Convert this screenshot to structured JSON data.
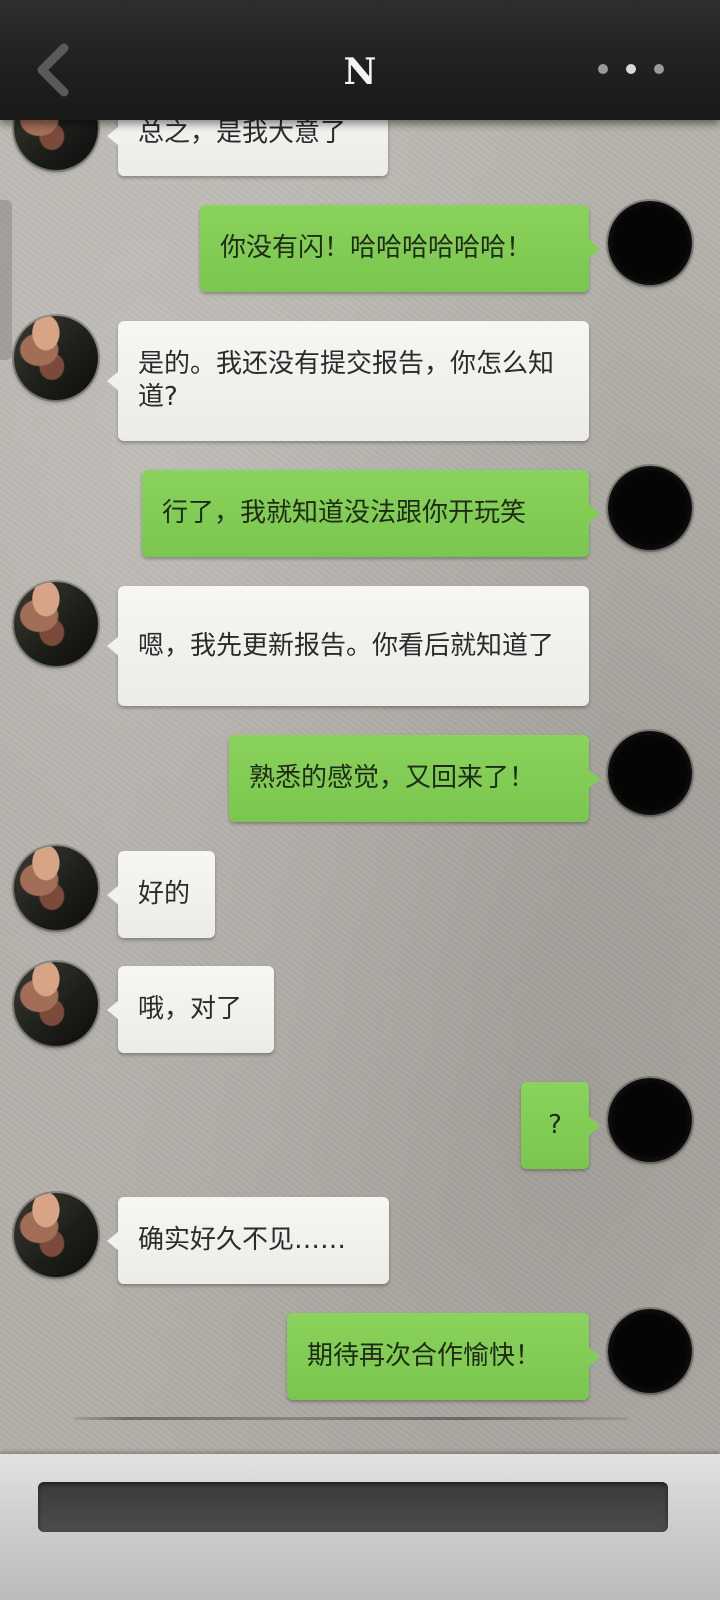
{
  "header": {
    "title": "N",
    "back_icon": "chevron-left-icon",
    "more_icon": "more-dots-icon"
  },
  "messages": [
    {
      "side": "left",
      "text": "总之，是我大意了"
    },
    {
      "side": "right",
      "text": "你没有闪！哈哈哈哈哈哈！"
    },
    {
      "side": "left",
      "text": "是的。我还没有提交报告，你怎么知道?"
    },
    {
      "side": "right",
      "text": "行了，我就知道没法跟你开玩笑"
    },
    {
      "side": "left",
      "text": "嗯，我先更新报告。你看后就知道了"
    },
    {
      "side": "right",
      "text": "熟悉的感觉，又回来了！"
    },
    {
      "side": "left",
      "text": "好的"
    },
    {
      "side": "left",
      "text": "哦，对了"
    },
    {
      "side": "right",
      "text": "?"
    },
    {
      "side": "left",
      "text": "确实好久不见……"
    },
    {
      "side": "right",
      "text": "期待再次合作愉快！"
    }
  ],
  "input": {
    "value": "",
    "placeholder": ""
  },
  "colors": {
    "header_bg": "#1f1f1f",
    "incoming_bubble": "#efefec",
    "outgoing_bubble": "#82cd55",
    "chat_bg": "#b2aea8"
  }
}
